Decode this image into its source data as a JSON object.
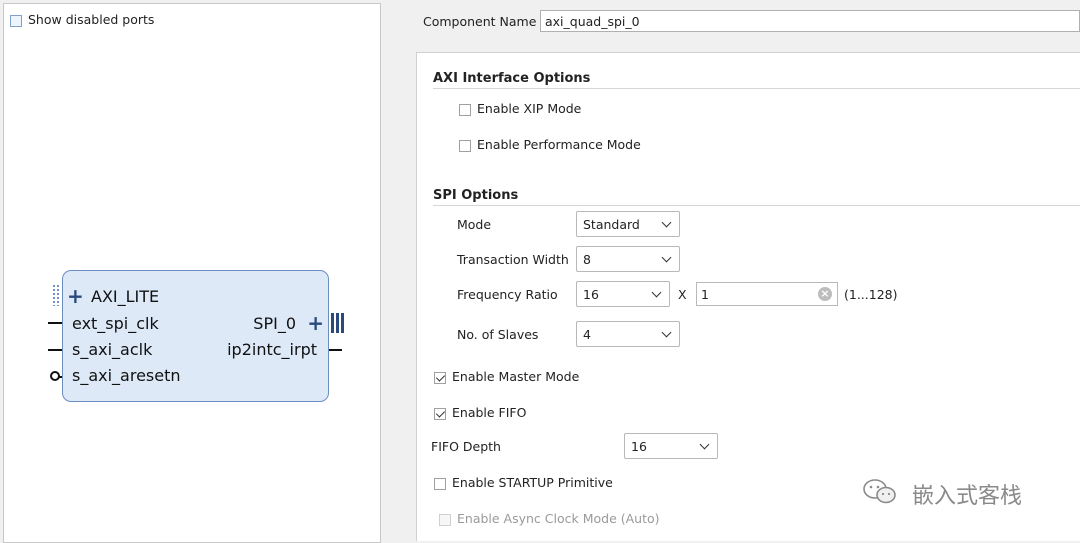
{
  "left": {
    "show_disabled_ports": "Show disabled ports",
    "block": {
      "axi_lite": "AXI_LITE",
      "ext_spi_clk": "ext_spi_clk",
      "s_axi_aclk": "s_axi_aclk",
      "s_axi_aresetn": "s_axi_aresetn",
      "spi_0": "SPI_0",
      "ip2intc_irpt": "ip2intc_irpt"
    }
  },
  "right": {
    "component_name_label": "Component Name",
    "component_name_value": "axi_quad_spi_0",
    "axi_section": "AXI Interface Options",
    "enable_xip": "Enable XIP Mode",
    "enable_perf": "Enable Performance Mode",
    "spi_section": "SPI Options",
    "mode_label": "Mode",
    "mode_value": "Standard",
    "tw_label": "Transaction Width",
    "tw_value": "8",
    "fr_label": "Frequency Ratio",
    "fr_value": "16",
    "x_label": "X",
    "fr_multiplier": "1",
    "fr_range": "(1...128)",
    "slaves_label": "No. of Slaves",
    "slaves_value": "4",
    "master_mode": "Enable Master Mode",
    "fifo": "Enable FIFO",
    "fifo_depth_label": "FIFO Depth",
    "fifo_depth_value": "16",
    "startup": "Enable STARTUP Primitive",
    "async_clock": "Enable Async Clock Mode (Auto)"
  },
  "watermark": "嵌入式客栈",
  "colors": {
    "block_fill": "#dde9f7",
    "block_border": "#6c8ebf",
    "accent": "#2a4a7e"
  }
}
